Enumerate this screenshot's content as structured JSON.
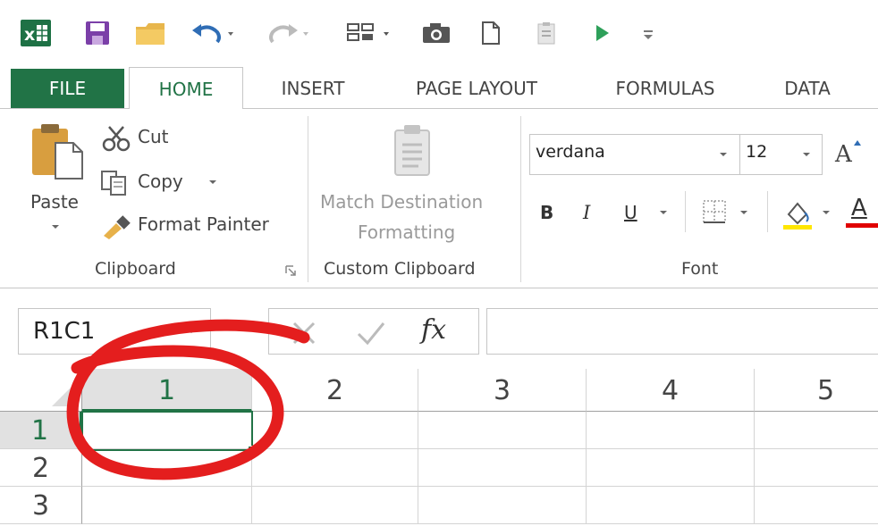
{
  "tabs": {
    "file": "FILE",
    "home": "HOME",
    "insert": "INSERT",
    "page_layout": "PAGE LAYOUT",
    "formulas": "FORMULAS",
    "data": "DATA"
  },
  "clipboard": {
    "paste": "Paste",
    "cut": "Cut",
    "copy": "Copy",
    "format_painter": "Format Painter",
    "group_label": "Clipboard"
  },
  "custom_clipboard": {
    "button_line1": "Match Destination",
    "button_line2": "Formatting",
    "group_label": "Custom Clipboard"
  },
  "font": {
    "name": "verdana",
    "size": "12",
    "group_label": "Font",
    "bold": "B",
    "italic": "I",
    "underline": "U",
    "grow": "A",
    "color_a": "A"
  },
  "formula_bar": {
    "name_box": "R1C1",
    "fx": "fx",
    "value": ""
  },
  "grid": {
    "columns": [
      "1",
      "2",
      "3",
      "4",
      "5"
    ],
    "rows": [
      "1",
      "2",
      "3"
    ]
  },
  "colors": {
    "excel_green": "#217346",
    "highlight_yellow": "#ffe600",
    "font_red": "#e00000",
    "annotation_red": "#e41e1e"
  }
}
